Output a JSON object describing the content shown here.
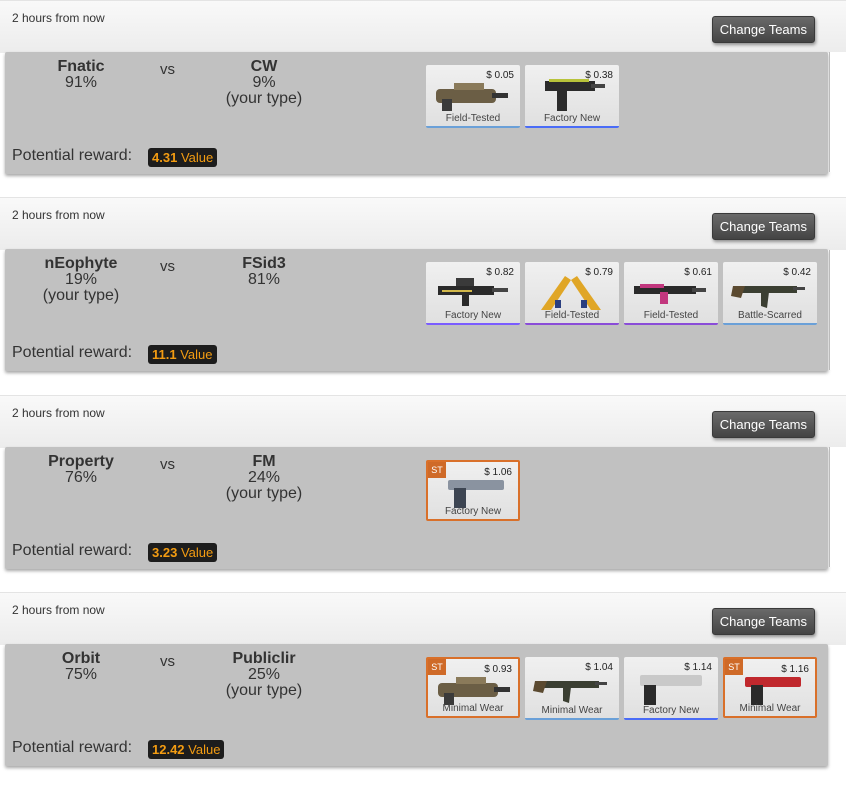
{
  "colors": {
    "card_bg": "#c1c1c1",
    "value_text": "#f39c12",
    "stattrak_border": "#d9702a"
  },
  "matches": [
    {
      "time": "2 hours from now",
      "change_label": "Change Teams",
      "vs": "vs",
      "team1": {
        "name": "Fnatic",
        "pct": "91%",
        "note": ""
      },
      "team2": {
        "name": "CW",
        "pct": "9%",
        "note": "(your type)"
      },
      "reward_label": "Potential reward:",
      "reward_value": "4.31",
      "reward_unit": "Value",
      "items": [
        {
          "price": "$ 0.05",
          "wear": "Field-Tested",
          "st": false,
          "icon": "p90-rifle-icon",
          "bar": "#6aa0d8"
        },
        {
          "price": "$ 0.38",
          "wear": "Factory New",
          "st": false,
          "icon": "tec9-pistol-icon",
          "bar": "#4a6cf7"
        }
      ]
    },
    {
      "time": "2 hours from now",
      "change_label": "Change Teams",
      "vs": "vs",
      "team1": {
        "name": "nEophyte",
        "pct": "19%",
        "note": "(your type)"
      },
      "team2": {
        "name": "FSid3",
        "pct": "81%",
        "note": ""
      },
      "reward_label": "Potential reward:",
      "reward_value": "11.1",
      "reward_unit": "Value",
      "items": [
        {
          "price": "$ 0.82",
          "wear": "Factory New",
          "st": false,
          "icon": "aug-rifle-icon",
          "bar": "#7a5cff"
        },
        {
          "price": "$ 0.79",
          "wear": "Field-Tested",
          "st": false,
          "icon": "dual-berettas-icon",
          "bar": "#8a4cd8"
        },
        {
          "price": "$ 0.61",
          "wear": "Field-Tested",
          "st": false,
          "icon": "sg553-rifle-icon",
          "bar": "#8a4cd8"
        },
        {
          "price": "$ 0.42",
          "wear": "Battle-Scarred",
          "st": false,
          "icon": "ak47-rifle-icon",
          "bar": "#6aa0d8"
        }
      ]
    },
    {
      "time": "2 hours from now",
      "change_label": "Change Teams",
      "vs": "vs",
      "team1": {
        "name": "Property",
        "pct": "76%",
        "note": ""
      },
      "team2": {
        "name": "FM",
        "pct": "24%",
        "note": "(your type)"
      },
      "reward_label": "Potential reward:",
      "reward_value": "3.23",
      "reward_unit": "Value",
      "items": [
        {
          "price": "$ 1.06",
          "wear": "Factory New",
          "st": true,
          "badge": "ST",
          "icon": "five-seven-pistol-icon",
          "bar": "#7a5cff"
        }
      ]
    },
    {
      "time": "2 hours from now",
      "change_label": "Change Teams",
      "vs": "vs",
      "team1": {
        "name": "Orbit",
        "pct": "75%",
        "note": ""
      },
      "team2": {
        "name": "Publiclir",
        "pct": "25%",
        "note": "(your type)"
      },
      "reward_label": "Potential reward:",
      "reward_value": "12.42",
      "reward_unit": "Value",
      "items": [
        {
          "price": "$ 0.93",
          "wear": "Minimal Wear",
          "st": true,
          "badge": "ST",
          "icon": "p90-rifle-icon",
          "bar": "#7a5cff"
        },
        {
          "price": "$ 1.04",
          "wear": "Minimal Wear",
          "st": false,
          "icon": "ak47-rifle-icon",
          "bar": "#6aa0d8"
        },
        {
          "price": "$ 1.14",
          "wear": "Factory New",
          "st": false,
          "icon": "desert-eagle-icon",
          "bar": "#4a6cf7"
        },
        {
          "price": "$ 1.16",
          "wear": "Minimal Wear",
          "st": true,
          "badge": "ST",
          "icon": "p2000-pistol-icon",
          "bar": "#7a5cff"
        }
      ]
    }
  ]
}
